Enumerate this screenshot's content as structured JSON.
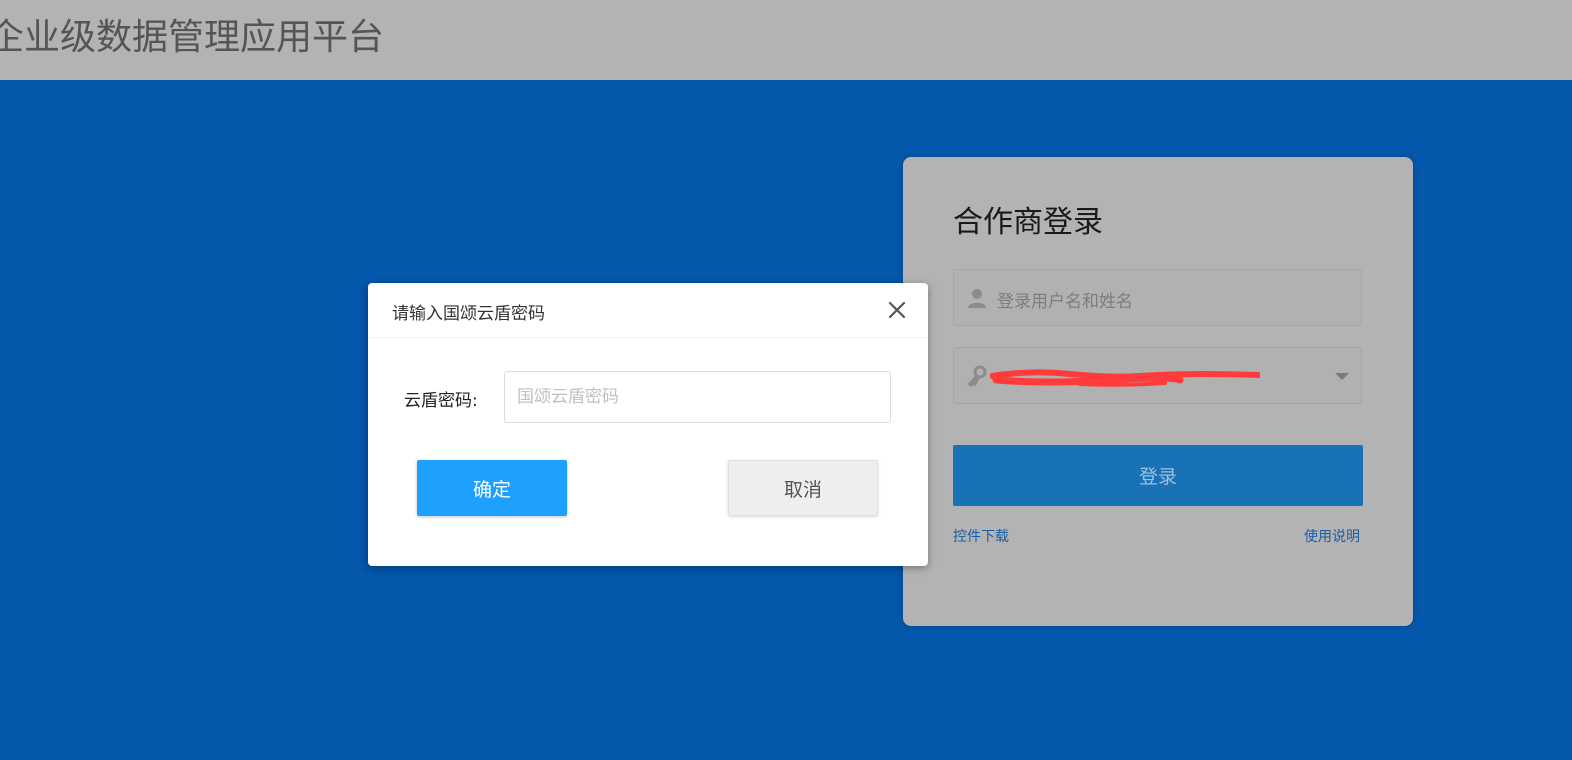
{
  "header": {
    "app_title": "企业级数据管理应用平台"
  },
  "login": {
    "title": "合作商登录",
    "username_placeholder": "登录用户名和姓名",
    "password_masked": "",
    "submit_label": "登录",
    "link_download": "控件下载",
    "link_help": "使用说明"
  },
  "modal": {
    "title": "请输入国颂云盾密码",
    "field_label": "云盾密码:",
    "field_placeholder": "国颂云盾密码",
    "field_value": "",
    "ok_label": "确定",
    "cancel_label": "取消"
  },
  "colors": {
    "header_bg": "#b3b3b3",
    "main_bg": "#0457ab",
    "primary_button": "#1ea0ff",
    "login_button": "#1a72b6",
    "redaction": "#ff3b3b"
  },
  "icons": {
    "username": "user-icon",
    "password": "key-icon",
    "dropdown": "caret-down-icon",
    "close": "close-icon"
  }
}
